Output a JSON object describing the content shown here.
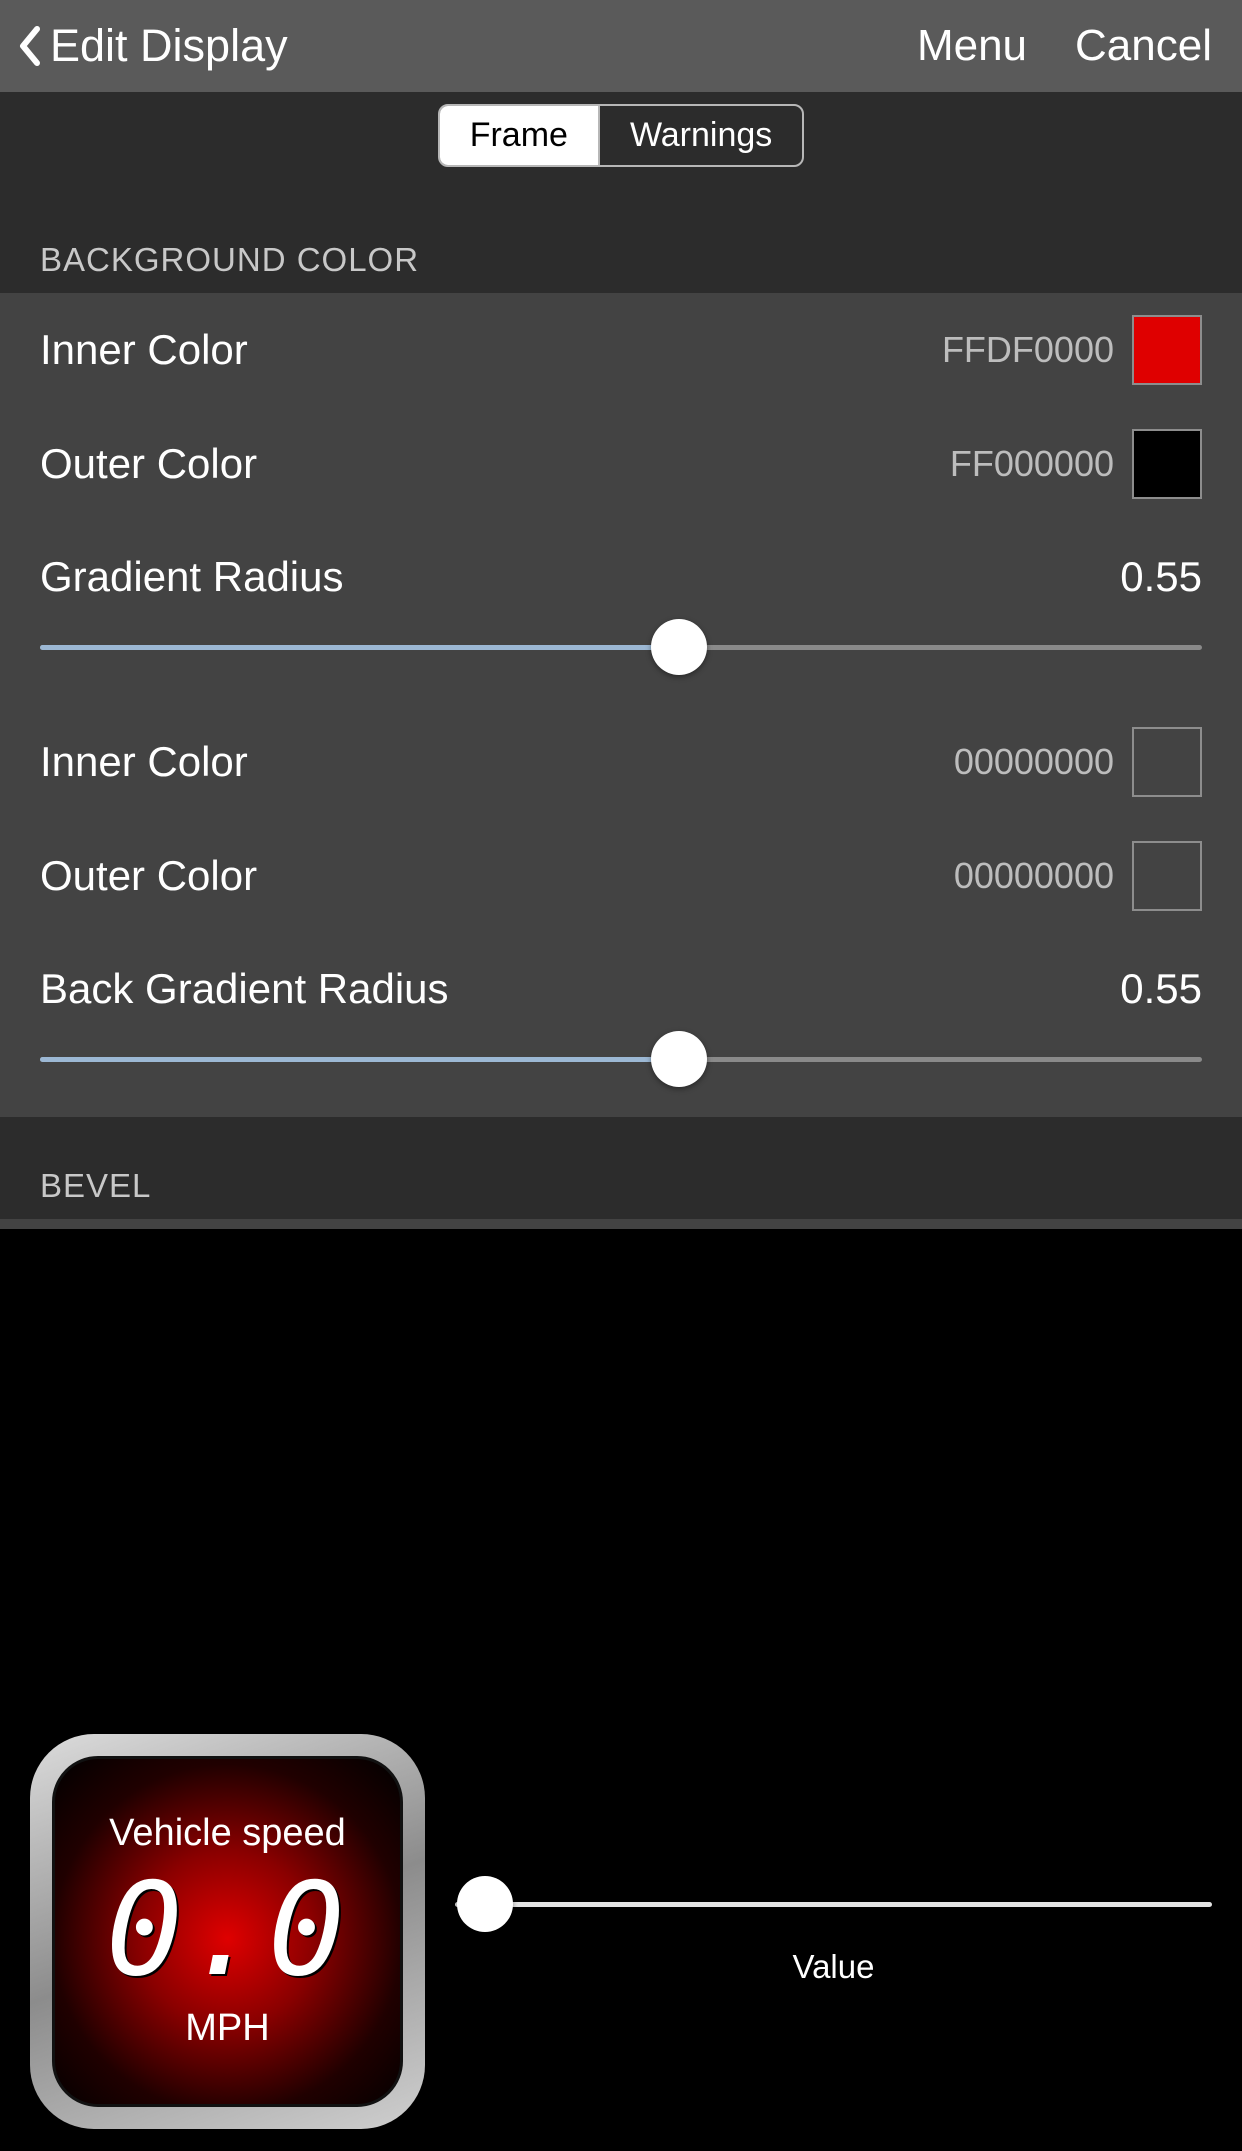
{
  "nav": {
    "back_label": "Edit Display",
    "menu_label": "Menu",
    "cancel_label": "Cancel"
  },
  "tabs": {
    "frame": "Frame",
    "warnings": "Warnings"
  },
  "sections": {
    "background_color": "BACKGROUND COLOR",
    "bevel": "BEVEL"
  },
  "bg1": {
    "inner_label": "Inner Color",
    "inner_hex": "FFDF0000",
    "inner_swatch": "#df0000",
    "outer_label": "Outer Color",
    "outer_hex": "FF000000",
    "outer_swatch": "#000000",
    "radius_label": "Gradient Radius",
    "radius_value": "0.55",
    "radius_pct": 55
  },
  "bg2": {
    "inner_label": "Inner Color",
    "inner_hex": "00000000",
    "inner_swatch": "transparent",
    "outer_label": "Outer Color",
    "outer_hex": "00000000",
    "outer_swatch": "transparent",
    "radius_label": "Back Gradient Radius",
    "radius_value": "0.55",
    "radius_pct": 55
  },
  "preview": {
    "title": "Vehicle speed",
    "value": "0.0",
    "unit": "MPH",
    "slider_label": "Value",
    "slider_pct": 0
  }
}
